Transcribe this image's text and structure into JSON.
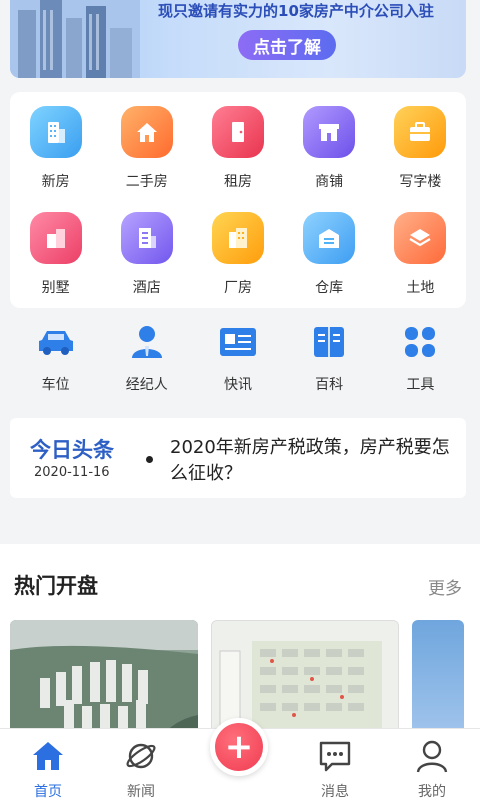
{
  "banner": {
    "text": "现只邀请有实力的10家房产中介公司入驻",
    "button": "点击了解"
  },
  "categories": {
    "row1": [
      {
        "label": "新房",
        "icon": "building-icon",
        "color": "#4fb6f5"
      },
      {
        "label": "二手房",
        "icon": "house-icon",
        "color": "#ff8a3d"
      },
      {
        "label": "租房",
        "icon": "door-icon",
        "color": "#f04f6a"
      },
      {
        "label": "商铺",
        "icon": "shop-icon",
        "color": "#8a6cf3"
      },
      {
        "label": "写字楼",
        "icon": "briefcase-icon",
        "color": "#ffb420"
      }
    ],
    "row2": [
      {
        "label": "别墅",
        "icon": "villa-icon",
        "color": "#f0577a"
      },
      {
        "label": "酒店",
        "icon": "hotel-icon",
        "color": "#8f76f5"
      },
      {
        "label": "厂房",
        "icon": "factory-icon",
        "color": "#ffae1e"
      },
      {
        "label": "仓库",
        "icon": "warehouse-icon",
        "color": "#52b2f6"
      },
      {
        "label": "土地",
        "icon": "layers-icon",
        "color": "#ff8150"
      }
    ]
  },
  "tools": [
    {
      "label": "车位",
      "icon": "car-icon"
    },
    {
      "label": "经纪人",
      "icon": "agent-icon"
    },
    {
      "label": "快讯",
      "icon": "newsflash-icon"
    },
    {
      "label": "百科",
      "icon": "book-icon"
    },
    {
      "label": "工具",
      "icon": "grid-icon"
    }
  ],
  "news": {
    "tag": "今日头条",
    "date": "2020-11-16",
    "title": "2020年新房产税政策，房产税要怎么征收？"
  },
  "hot": {
    "title": "热门开盘",
    "more": "更多"
  },
  "nav": [
    {
      "label": "首页",
      "icon": "home-icon",
      "active": true
    },
    {
      "label": "新闻",
      "icon": "planet-icon",
      "active": false
    },
    {
      "label": "消息",
      "icon": "message-icon",
      "active": false
    },
    {
      "label": "我的",
      "icon": "user-icon",
      "active": false
    }
  ],
  "fab": {
    "label": "+"
  }
}
